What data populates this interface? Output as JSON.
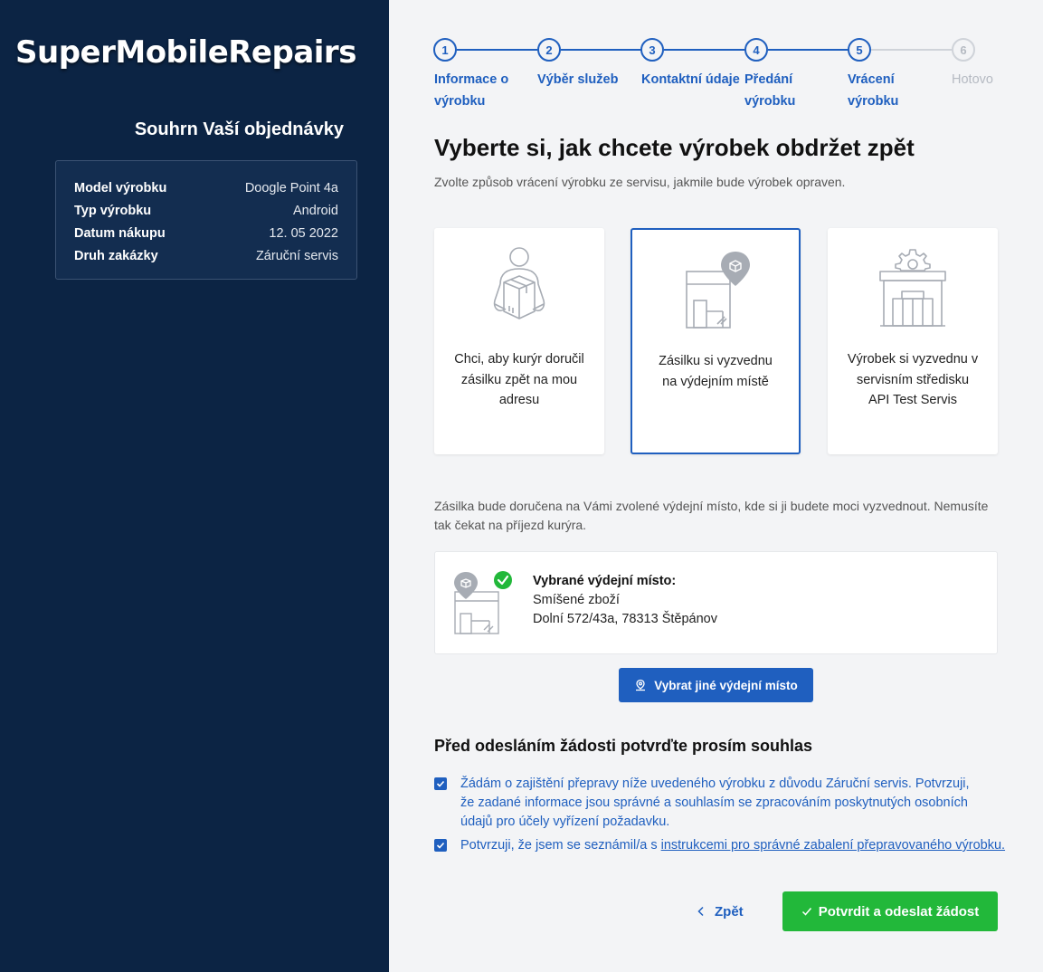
{
  "brand": "SuperMobileRepairs",
  "summary": {
    "title": "Souhrn Vaší objednávky",
    "rows": [
      {
        "label": "Model výrobku",
        "value": "Doogle Point 4a"
      },
      {
        "label": "Typ výrobku",
        "value": "Android"
      },
      {
        "label": "Datum nákupu",
        "value": "12. 05 2022"
      },
      {
        "label": "Druh zakázky",
        "value": "Záruční servis"
      }
    ]
  },
  "stepper": {
    "steps": [
      {
        "number": "1",
        "label": "Informace o výrobku"
      },
      {
        "number": "2",
        "label": "Výběr služeb"
      },
      {
        "number": "3",
        "label": "Kontaktní údaje"
      },
      {
        "number": "4",
        "label": "Předání výrobku"
      },
      {
        "number": "5",
        "label": "Vrácení výrobku"
      },
      {
        "number": "6",
        "label": "Hotovo"
      }
    ]
  },
  "heading": "Vyberte si, jak chcete výrobek obdržet zpět",
  "subheading": "Zvolte způsob vrácení výrobku ze servisu, jakmile bude výrobek opraven.",
  "options": [
    {
      "label": "Chci, aby kurýr doručil zásilku zpět na mou adresu",
      "icon": "courier-box-icon",
      "selected": false
    },
    {
      "label": "Zásilku si vyzvednu na výdejním místě",
      "icon": "pickup-point-icon",
      "selected": true
    },
    {
      "label": "Výrobek si vyzvednu v servisním středisku API Test Servis",
      "icon": "service-center-icon",
      "selected": false
    }
  ],
  "info_text": "Zásilka bude doručena na Vámi zvolené výdejní místo, kde si ji budete moci vyzvednout. Nemusíte tak čekat na příjezd kurýra.",
  "pickup": {
    "title": "Vybrané výdejní místo:",
    "name": "Smíšené zboží",
    "address": "Dolní 572/43a, 78313 Štěpánov"
  },
  "pick_button": "Vybrat jiné výdejní místo",
  "consent": {
    "title": "Před odesláním žádosti potvrďte prosím souhlas",
    "item1": "Žádám o zajištění přepravy níže uvedeného výrobku z důvodu Záruční servis. Potvrzuji, že zadané informace jsou správné a souhlasím se zpracováním poskytnutých osobních údajů pro účely vyřízení požadavku.",
    "item2_prefix": "Potvrzuji, že jsem se seznámil/a s ",
    "item2_link": "instrukcemi pro správné zabalení přepravovaného výrobku."
  },
  "back_button": "Zpět",
  "submit_button": "Potvrdit a odeslat žádost",
  "colors": {
    "sidebar": "#0c2444",
    "accent": "#1f5fbf",
    "success": "#22b83a"
  }
}
